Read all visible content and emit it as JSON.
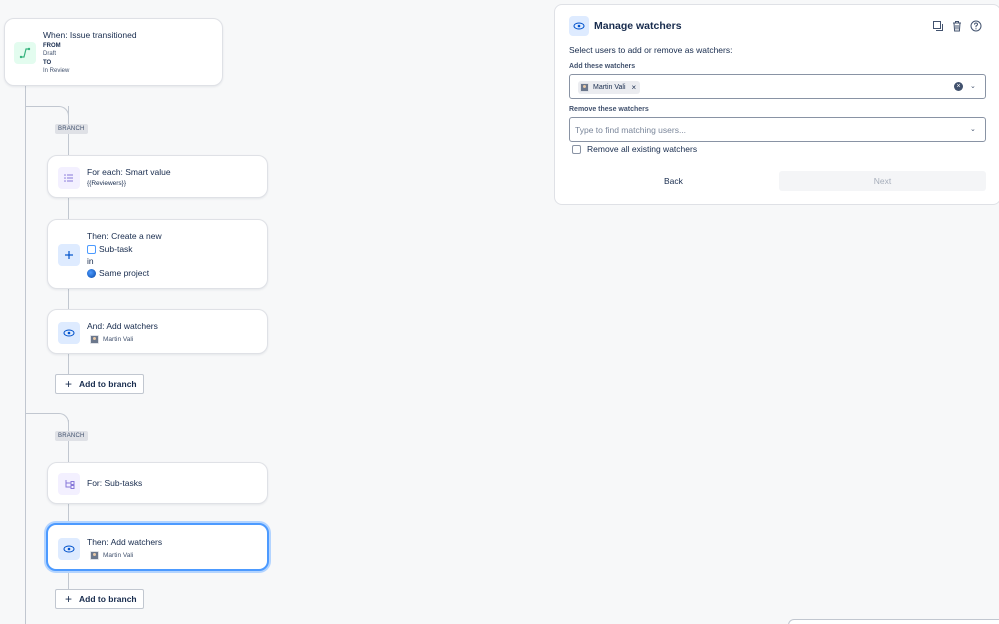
{
  "trigger": {
    "title": "When: Issue transitioned",
    "from_label": "FROM",
    "from_value": "Draft",
    "to_label": "TO",
    "to_value": "In Review",
    "icon": "transition-icon"
  },
  "branch1": {
    "tag": "BRANCH",
    "foreach": {
      "title": "For each: Smart value",
      "value": "{{Reviewers}}",
      "icon": "list-icon"
    },
    "create": {
      "title": "Then: Create a new",
      "issue_type": "Sub-task",
      "in_label": "in",
      "project": "Same project",
      "icon": "plus-icon"
    },
    "watchers": {
      "title": "And: Add watchers",
      "user": "Martin Vali",
      "icon": "eye-icon"
    },
    "add_label": "Add to branch"
  },
  "branch2": {
    "tag": "BRANCH",
    "for": {
      "title": "For: Sub-tasks",
      "icon": "subtasks-icon"
    },
    "watchers": {
      "title": "Then: Add watchers",
      "user": "Martin Vali",
      "icon": "eye-icon"
    },
    "add_label": "Add to branch"
  },
  "panel": {
    "title": "Manage watchers",
    "instructions": "Select users to add or remove as watchers:",
    "add_label": "Add these watchers",
    "add_chip": "Martin Vali",
    "remove_label": "Remove these watchers",
    "remove_placeholder": "Type to find matching users...",
    "checkbox_label": "Remove all existing watchers",
    "back": "Back",
    "next": "Next",
    "icons": [
      "eye-icon",
      "duplicate-icon",
      "trash-icon",
      "help-icon"
    ]
  },
  "colors": {
    "accent": "#4c9aff",
    "trigger_icon_bg": "#e3fcef",
    "branch_icon_bg": "#f3f0ff",
    "action_icon_bg": "#deebff"
  }
}
